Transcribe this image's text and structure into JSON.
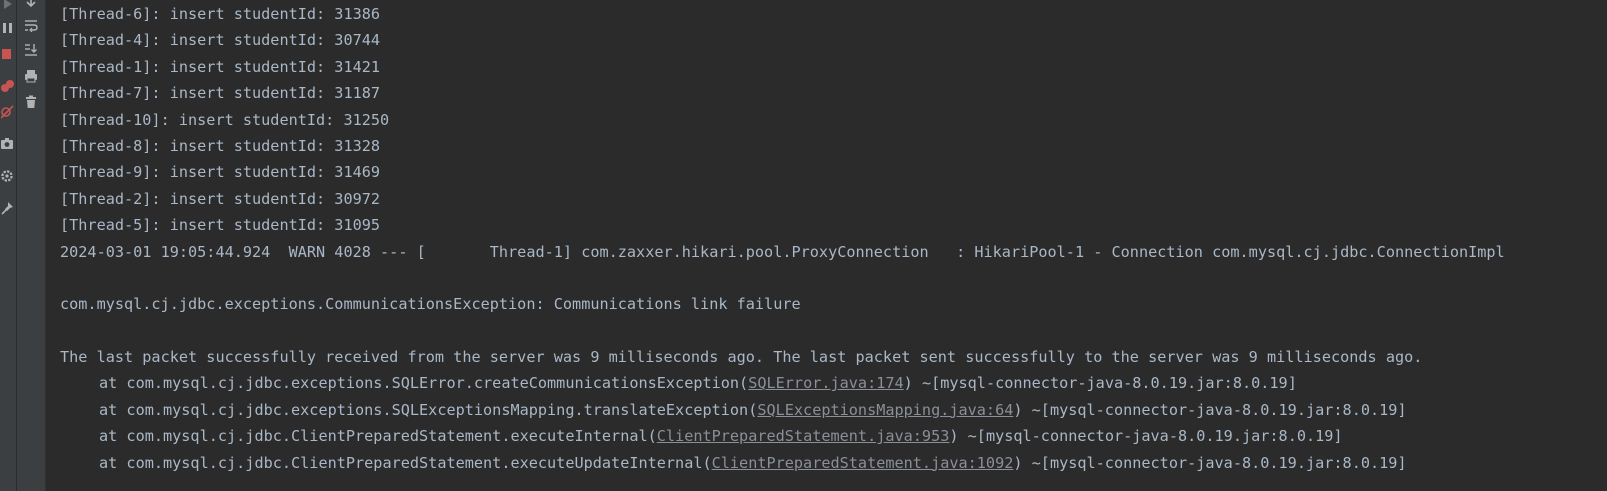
{
  "toolbar": {
    "left_icons": [
      {
        "icon": "play-icon",
        "color": "#6e7073"
      },
      {
        "icon": "pause-icon",
        "color": "#b2b2b2"
      },
      {
        "icon": "stop-icon",
        "color": "#c75450"
      },
      {
        "icon": "view-breakpoints-icon",
        "color": "#c75450"
      },
      {
        "icon": "mute-breakpoints-icon",
        "color": "#c75450"
      },
      {
        "icon": "camera-icon",
        "color": "#b2b2b2"
      },
      {
        "icon": "settings-icon",
        "color": "#b2b2b2"
      },
      {
        "icon": "pin-icon",
        "color": "#b2b2b2"
      }
    ],
    "right_icons": [
      {
        "icon": "scroll-down-icon",
        "color": "#b2b2b2"
      },
      {
        "icon": "soft-wrap-icon",
        "color": "#b2b2b2"
      },
      {
        "icon": "scroll-to-end-icon",
        "color": "#b2b2b2"
      },
      {
        "icon": "print-icon",
        "color": "#b2b2b2"
      },
      {
        "icon": "trash-icon",
        "color": "#b2b2b2"
      }
    ]
  },
  "console": {
    "colors": {
      "text": "#a9b7c6",
      "link": "#8a8f98",
      "background": "#2b2b2b"
    },
    "lines": [
      {
        "type": "text",
        "text": "[Thread-6]: insert studentId: 31386"
      },
      {
        "type": "text",
        "text": "[Thread-4]: insert studentId: 30744"
      },
      {
        "type": "text",
        "text": "[Thread-1]: insert studentId: 31421"
      },
      {
        "type": "text",
        "text": "[Thread-7]: insert studentId: 31187"
      },
      {
        "type": "text",
        "text": "[Thread-10]: insert studentId: 31250"
      },
      {
        "type": "text",
        "text": "[Thread-8]: insert studentId: 31328"
      },
      {
        "type": "text",
        "text": "[Thread-9]: insert studentId: 31469"
      },
      {
        "type": "text",
        "text": "[Thread-2]: insert studentId: 30972"
      },
      {
        "type": "text",
        "text": "[Thread-5]: insert studentId: 31095"
      },
      {
        "type": "text",
        "text": "2024-03-01 19:05:44.924  WARN 4028 --- [       Thread-1] com.zaxxer.hikari.pool.ProxyConnection   : HikariPool-1 - Connection com.mysql.cj.jdbc.ConnectionImpl"
      },
      {
        "type": "blank",
        "text": ""
      },
      {
        "type": "text",
        "text": "com.mysql.cj.jdbc.exceptions.CommunicationsException: Communications link failure"
      },
      {
        "type": "blank",
        "text": ""
      },
      {
        "type": "text",
        "text": "The last packet successfully received from the server was 9 milliseconds ago. The last packet sent successfully to the server was 9 milliseconds ago."
      },
      {
        "type": "stack",
        "prefix": "at com.mysql.cj.jdbc.exceptions.SQLError.createCommunicationsException(",
        "link": "SQLError.java:174",
        "suffix": ") ~[mysql-connector-java-8.0.19.jar:8.0.19]"
      },
      {
        "type": "stack",
        "prefix": "at com.mysql.cj.jdbc.exceptions.SQLExceptionsMapping.translateException(",
        "link": "SQLExceptionsMapping.java:64",
        "suffix": ") ~[mysql-connector-java-8.0.19.jar:8.0.19]"
      },
      {
        "type": "stack",
        "prefix": "at com.mysql.cj.jdbc.ClientPreparedStatement.executeInternal(",
        "link": "ClientPreparedStatement.java:953",
        "suffix": ") ~[mysql-connector-java-8.0.19.jar:8.0.19]"
      },
      {
        "type": "stack",
        "prefix": "at com.mysql.cj.jdbc.ClientPreparedStatement.executeUpdateInternal(",
        "link": "ClientPreparedStatement.java:1092",
        "suffix": ") ~[mysql-connector-java-8.0.19.jar:8.0.19]"
      }
    ]
  }
}
